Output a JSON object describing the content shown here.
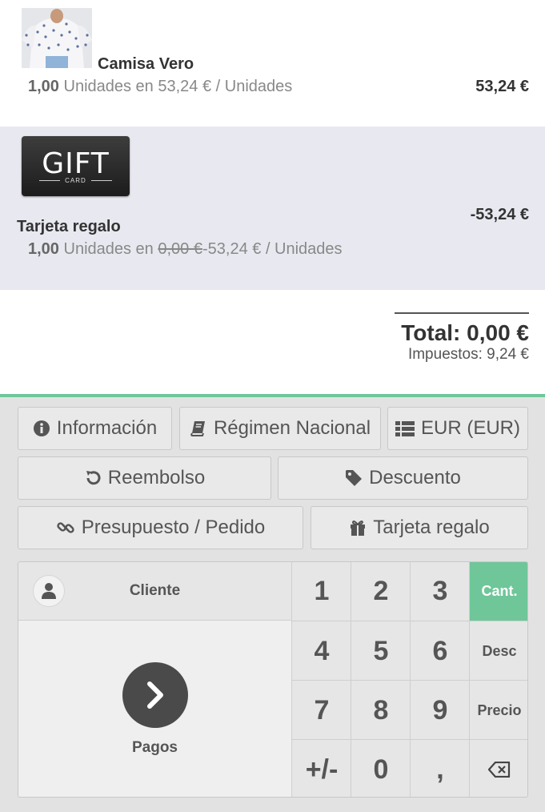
{
  "orderlines": [
    {
      "name": "Camisa Vero",
      "qty": "1,00",
      "unit_text": "Unidades en",
      "unit_price": "53,24 €",
      "per_unit": "/ Unidades",
      "price": "53,24 €"
    },
    {
      "thumb_word": "GIFT",
      "thumb_sub": "CARD",
      "name": "Tarjeta regalo",
      "qty": "1,00",
      "unit_text": "Unidades en",
      "old_price": "0,00 €",
      "unit_price": "-53,24 €",
      "per_unit": "/ Unidades",
      "price": "-53,24 €"
    }
  ],
  "summary": {
    "total": "Total: 0,00 €",
    "taxes": "Impuestos: 9,24 €"
  },
  "controls": {
    "info": "Información",
    "fiscal": "Régimen Nacional",
    "currency": "EUR (EUR)",
    "refund": "Reembolso",
    "discount": "Descuento",
    "quotation": "Presupuesto / Pedido",
    "giftcard": "Tarjeta regalo"
  },
  "numpad": {
    "customer": "Cliente",
    "payment": "Pagos",
    "keys": [
      "1",
      "2",
      "3",
      "4",
      "5",
      "6",
      "7",
      "8",
      "9",
      "+/-",
      "0",
      ","
    ],
    "modes": [
      "Cant.",
      "Desc",
      "Precio"
    ],
    "active_mode": "Cant."
  },
  "colors": {
    "accent": "#6ec699",
    "highlight_row": "#e8e9f0",
    "pad_bg": "#e2e2e2"
  },
  "icons": [
    "info-circle-icon",
    "book-icon",
    "list-icon",
    "undo-icon",
    "tag-icon",
    "link-icon",
    "gift-icon",
    "user-icon",
    "chevron-right-icon",
    "backspace-icon"
  ]
}
